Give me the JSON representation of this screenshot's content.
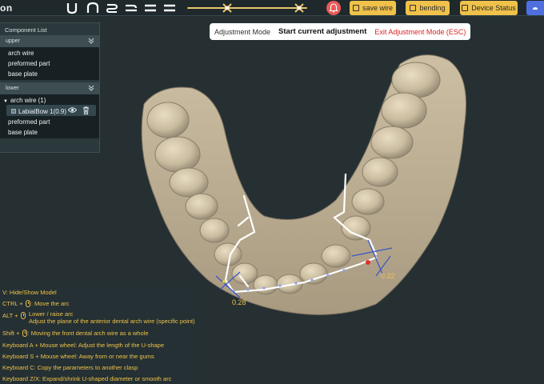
{
  "app": {
    "brand": "on"
  },
  "toolbar": {
    "shape_tools": [
      "u-shape-icon",
      "arch-icon",
      "wave-icon",
      "double-line-icon",
      "parallel-line-icon"
    ],
    "save_wire": "save wire",
    "bending": "bending",
    "device_status": "Device Status"
  },
  "adjustment": {
    "mode_label": "Adjustment Mode",
    "current": "Start current adjustment",
    "exit": "Exit Adjustment Mode (ESC)"
  },
  "component_panel": {
    "title": "Component List",
    "groups": [
      {
        "name": "upper",
        "items": [
          "arch wire",
          "preformed part",
          "base plate"
        ]
      },
      {
        "name": "lower",
        "parent_item": "arch wire (1)",
        "selected_item": "LabialBow 1(0.9)",
        "items": [
          "preformed part",
          "base plate"
        ]
      }
    ]
  },
  "help": {
    "lines": [
      {
        "key": "V:",
        "text": "Hide/Show Model"
      },
      {
        "key": "CTRL +",
        "text": ": Move the arc"
      },
      {
        "key": "ALT +",
        "text": "Lower / raise arc",
        "text2": "Adjust the plane of the anterior dental arch wire (specific point)"
      },
      {
        "key": "Shift +",
        "text": ": Moving the front dental arch wire as a whole"
      },
      {
        "key": "",
        "text": "Keyboard A + Mouse wheel: Adjust the length of the U-shape"
      },
      {
        "key": "",
        "text": "Keyboard S + Mouse wheel: Away from or near the gums"
      },
      {
        "key": "",
        "text": "Keyboard C: Copy the parameters to another clasp"
      },
      {
        "key": "",
        "text": "Keyboard Z/X: Expand/shrink U-shaped diameter or smooth arc"
      }
    ]
  },
  "measurements": {
    "left": "0.28",
    "right": "0.22"
  },
  "colors": {
    "background": "#263033",
    "accent_yellow": "#f0c24a",
    "exit_red": "#e02020",
    "record_red": "#e85a5a",
    "model": "#cbbfa5",
    "wire": "#ffffff"
  }
}
